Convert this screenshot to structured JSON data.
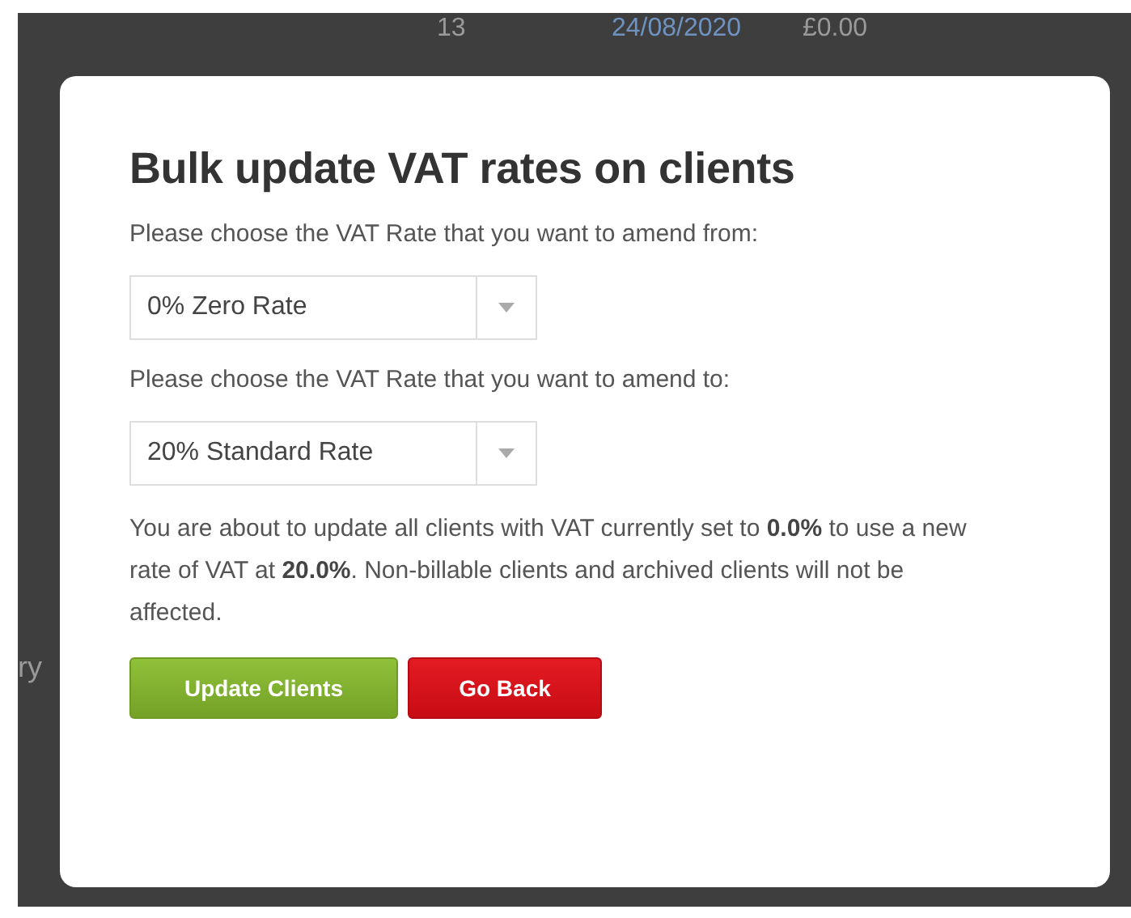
{
  "background_row": {
    "cells": [
      "13",
      "24/08/2020",
      "£0.00"
    ],
    "side_text": "ry"
  },
  "dialog": {
    "title": "Bulk update VAT rates on clients",
    "from_label": "Please choose the VAT Rate that you want to amend from:",
    "from_value": "0% Zero Rate",
    "to_label": "Please choose the VAT Rate that you want to amend to:",
    "to_value": "20% Standard Rate",
    "message": "You are about to update all clients with VAT currently set to **0.0%** to use a new rate of VAT at **20.0%**. Non-billable clients and archived clients will not be affected.",
    "buttons": [
      {
        "label": "Update Clients",
        "kind": "primary"
      },
      {
        "label": "Go Back",
        "kind": "danger"
      }
    ]
  }
}
